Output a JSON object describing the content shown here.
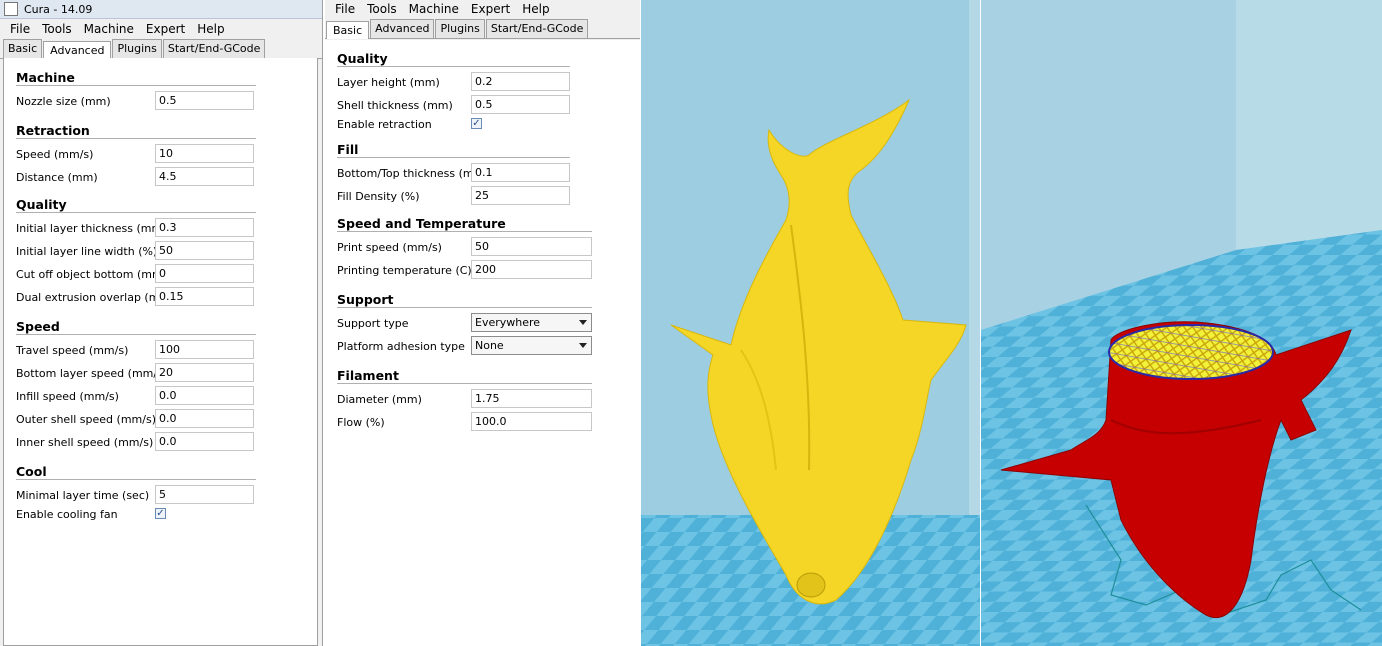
{
  "left": {
    "window_title": "Cura - 14.09",
    "menu": [
      "File",
      "Tools",
      "Machine",
      "Expert",
      "Help"
    ],
    "tabs": [
      "Basic",
      "Advanced",
      "Plugins",
      "Start/End-GCode"
    ],
    "sections": {
      "machine": "Machine",
      "retraction": "Retraction",
      "quality": "Quality",
      "speed": "Speed",
      "cool": "Cool"
    },
    "fields": [
      {
        "label": "Nozzle size (mm)",
        "value": "0.5"
      },
      {
        "label": "Speed (mm/s)",
        "value": "10"
      },
      {
        "label": "Distance (mm)",
        "value": "4.5"
      },
      {
        "label": "Initial layer thickness (mm)",
        "value": "0.3"
      },
      {
        "label": "Initial layer line width (%)",
        "value": "50"
      },
      {
        "label": "Cut off object bottom (mm)",
        "value": "0"
      },
      {
        "label": "Dual extrusion overlap (mm)",
        "value": "0.15"
      },
      {
        "label": "Travel speed (mm/s)",
        "value": "100"
      },
      {
        "label": "Bottom layer speed (mm/s)",
        "value": "20"
      },
      {
        "label": "Infill speed (mm/s)",
        "value": "0.0"
      },
      {
        "label": "Outer shell speed (mm/s)",
        "value": "0.0"
      },
      {
        "label": "Inner shell speed (mm/s)",
        "value": "0.0"
      },
      {
        "label": "Minimal layer time (sec)",
        "value": "5"
      }
    ],
    "cooling_fan": {
      "label": "Enable cooling fan",
      "checked": true
    }
  },
  "mid": {
    "menu": [
      "File",
      "Tools",
      "Machine",
      "Expert",
      "Help"
    ],
    "tabs": [
      "Basic",
      "Advanced",
      "Plugins",
      "Start/End-GCode"
    ],
    "sections": {
      "quality": "Quality",
      "fill": "Fill",
      "speed_temp": "Speed and Temperature",
      "support": "Support",
      "filament": "Filament"
    },
    "fields": [
      {
        "label": "Layer height (mm)",
        "value": "0.2"
      },
      {
        "label": "Shell thickness (mm)",
        "value": "0.5"
      },
      {
        "label": "Bottom/Top thickness (mm)",
        "value": "0.1"
      },
      {
        "label": "Fill Density (%)",
        "value": "25"
      },
      {
        "label": "Print speed (mm/s)",
        "value": "50"
      },
      {
        "label": "Printing temperature (C)",
        "value": "200"
      },
      {
        "label": "Diameter (mm)",
        "value": "1.75"
      },
      {
        "label": "Flow (%)",
        "value": "100.0"
      }
    ],
    "retraction": {
      "label": "Enable retraction",
      "checked": true
    },
    "support_type": {
      "label": "Support type",
      "value": "Everywhere"
    },
    "platform_adhesion": {
      "label": "Platform adhesion type",
      "value": "None"
    }
  },
  "colors": {
    "panel_bg": "#f0f0f0",
    "viewport_wall": "#9ccde0",
    "viewport_floor": "#5fb8dc",
    "model_yellow": "#f5d626",
    "model_red": "#c60000",
    "infill_yellow": "#f2f23a",
    "outline_blue": "#2a2aa8"
  }
}
